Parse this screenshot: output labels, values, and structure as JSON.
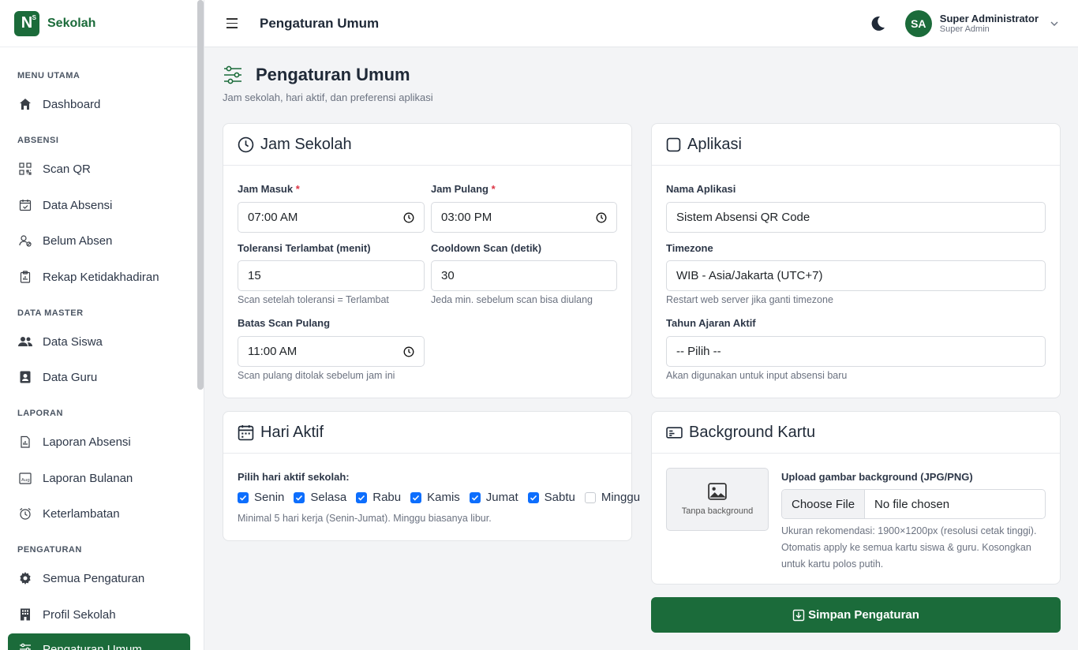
{
  "brand": {
    "logo": "N",
    "logo_mark": "S",
    "name": "Sekolah"
  },
  "sidebar": {
    "sections": {
      "main": "MENU UTAMA",
      "absensi": "ABSENSI",
      "master": "DATA MASTER",
      "laporan": "LAPORAN",
      "pengaturan": "PENGATURAN"
    },
    "items": {
      "dashboard": "Dashboard",
      "scan_qr": "Scan QR",
      "data_absensi": "Data Absensi",
      "belum_absen": "Belum Absen",
      "rekap": "Rekap Ketidakhadiran",
      "data_siswa": "Data Siswa",
      "data_guru": "Data Guru",
      "laporan_absensi": "Laporan Absensi",
      "laporan_bulanan": "Laporan Bulanan",
      "keterlambatan": "Keterlambatan",
      "semua_pengaturan": "Semua Pengaturan",
      "profil_sekolah": "Profil Sekolah",
      "pengaturan_umum": "Pengaturan Umum"
    }
  },
  "topbar": {
    "title": "Pengaturan Umum",
    "user": {
      "initials": "SA",
      "name": "Super Administrator",
      "role": "Super Admin"
    }
  },
  "page": {
    "title": "Pengaturan Umum",
    "subtitle": "Jam sekolah, hari aktif, dan preferensi aplikasi"
  },
  "jam_sekolah": {
    "title": "Jam Sekolah",
    "jam_masuk_label": "Jam Masuk",
    "jam_masuk_value": "07:00 AM",
    "jam_pulang_label": "Jam Pulang",
    "jam_pulang_value": "03:00 PM",
    "toleransi_label": "Toleransi Terlambat (menit)",
    "toleransi_value": "15",
    "toleransi_hint": "Scan setelah toleransi = Terlambat",
    "cooldown_label": "Cooldown Scan (detik)",
    "cooldown_value": "30",
    "cooldown_hint": "Jeda min. sebelum scan bisa diulang",
    "batas_label": "Batas Scan Pulang",
    "batas_value": "11:00 AM",
    "batas_hint": "Scan pulang ditolak sebelum jam ini",
    "required_mark": "*"
  },
  "aplikasi": {
    "title": "Aplikasi",
    "nama_label": "Nama Aplikasi",
    "nama_value": "Sistem Absensi QR Code",
    "timezone_label": "Timezone",
    "timezone_value": "WIB - Asia/Jakarta (UTC+7)",
    "timezone_hint": "Restart web server jika ganti timezone",
    "tahun_label": "Tahun Ajaran Aktif",
    "tahun_value": "-- Pilih --",
    "tahun_hint": "Akan digunakan untuk input absensi baru"
  },
  "hari_aktif": {
    "title": "Hari Aktif",
    "prompt": "Pilih hari aktif sekolah:",
    "days": [
      {
        "label": "Senin",
        "checked": true
      },
      {
        "label": "Selasa",
        "checked": true
      },
      {
        "label": "Rabu",
        "checked": true
      },
      {
        "label": "Kamis",
        "checked": true
      },
      {
        "label": "Jumat",
        "checked": true
      },
      {
        "label": "Sabtu",
        "checked": true
      },
      {
        "label": "Minggu",
        "checked": false
      }
    ],
    "hint": "Minimal 5 hari kerja (Senin-Jumat). Minggu biasanya libur."
  },
  "background_kartu": {
    "title": "Background Kartu",
    "preview_text": "Tanpa background",
    "upload_label": "Upload gambar background (JPG/PNG)",
    "choose_file": "Choose File",
    "no_file": "No file chosen",
    "hint_line1": "Ukuran rekomendasi: 1900×1200px (resolusi cetak tinggi).",
    "hint_line2": "Otomatis apply ke semua kartu siswa & guru. Kosongkan",
    "hint_line3": "untuk kartu polos putih."
  },
  "save_button": "Simpan Pengaturan",
  "colors": {
    "primary": "#1b6b3a",
    "checkbox": "#0d6efd",
    "required": "#dc3545"
  }
}
